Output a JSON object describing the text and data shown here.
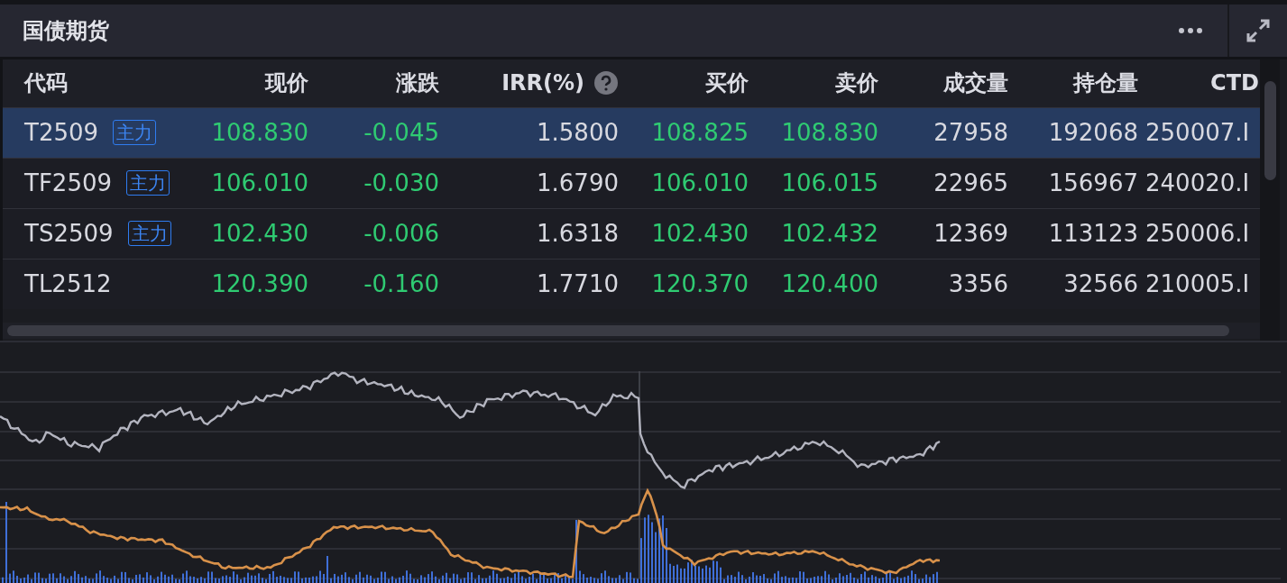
{
  "panel": {
    "title": "国债期货"
  },
  "table": {
    "columns": [
      {
        "label": "代码",
        "help": false
      },
      {
        "label": "现价",
        "help": false
      },
      {
        "label": "涨跌",
        "help": false
      },
      {
        "label": "IRR(%)",
        "help": true
      },
      {
        "label": "买价",
        "help": false
      },
      {
        "label": "卖价",
        "help": false
      },
      {
        "label": "成交量",
        "help": false
      },
      {
        "label": "持仓量",
        "help": false
      },
      {
        "label": "CTD",
        "help": false
      }
    ],
    "rows": [
      {
        "selected": true,
        "code": "T2509",
        "badge": "主力",
        "price": "108.830",
        "change": "-0.045",
        "irr": "1.5800",
        "bid": "108.825",
        "ask": "108.830",
        "volume": "27958",
        "open_interest": "192068",
        "ctd": "250007.I"
      },
      {
        "selected": false,
        "code": "TF2509",
        "badge": "主力",
        "price": "106.010",
        "change": "-0.030",
        "irr": "1.6790",
        "bid": "106.010",
        "ask": "106.015",
        "volume": "22965",
        "open_interest": "156967",
        "ctd": "240020.I"
      },
      {
        "selected": false,
        "code": "TS2509",
        "badge": "主力",
        "price": "102.430",
        "change": "-0.006",
        "irr": "1.6318",
        "bid": "102.430",
        "ask": "102.432",
        "volume": "12369",
        "open_interest": "113123",
        "ctd": "250006.I"
      },
      {
        "selected": false,
        "code": "TL2512",
        "price": "120.390",
        "change": "-0.160",
        "irr": "1.7710",
        "bid": "120.370",
        "ask": "120.400",
        "volume": "3356",
        "open_interest": "32566",
        "ctd": "210005.I"
      }
    ]
  }
}
